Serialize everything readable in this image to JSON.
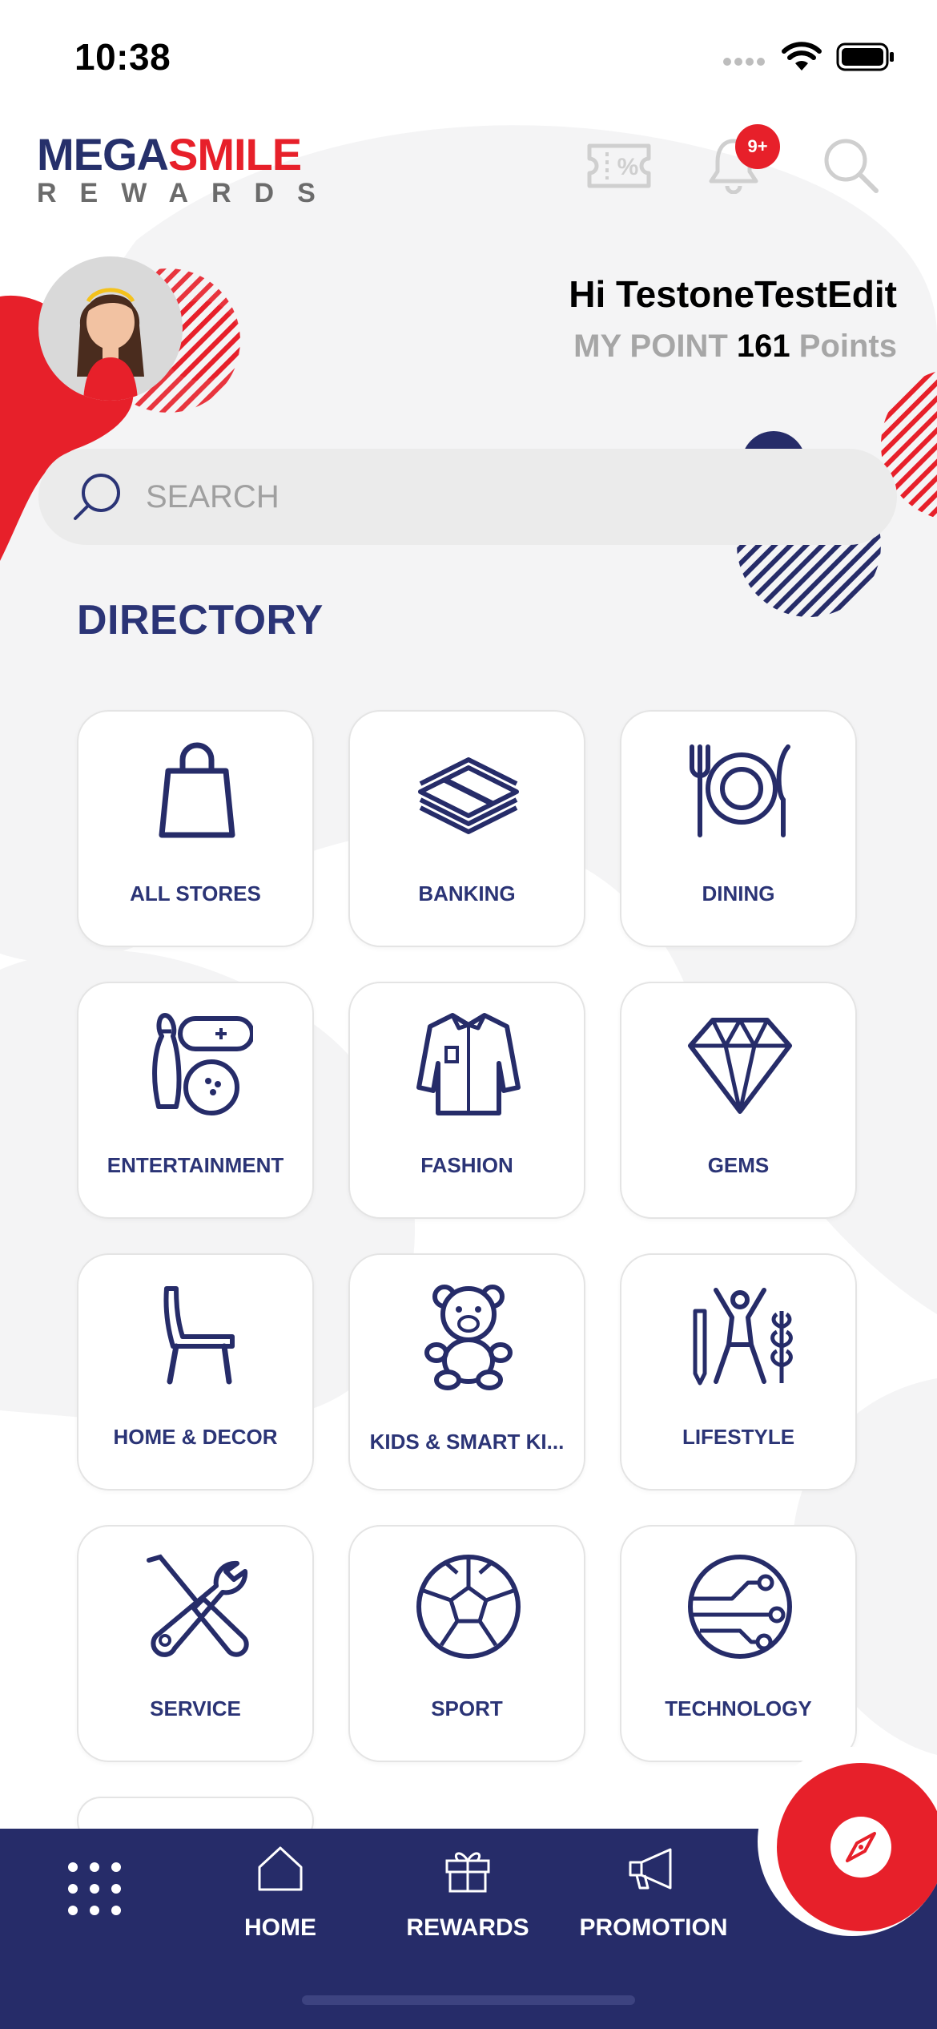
{
  "status_bar": {
    "time": "10:38"
  },
  "header": {
    "logo_top_a": "MEGA",
    "logo_top_b": "SMILE",
    "logo_bottom": "REWARDS",
    "notification_badge": "9+",
    "icons": [
      "coupon-icon",
      "bell-icon",
      "search-icon"
    ]
  },
  "profile": {
    "greeting": "Hi TestoneTestEdit",
    "points_prefix": "MY POINT",
    "points_value": "161",
    "points_suffix": "Points"
  },
  "search": {
    "placeholder": "SEARCH"
  },
  "directory": {
    "title": "DIRECTORY",
    "items": [
      {
        "label": "ALL STORES",
        "icon": "shopping-bag-icon"
      },
      {
        "label": "BANKING",
        "icon": "money-stack-icon"
      },
      {
        "label": "DINING",
        "icon": "dining-plate-icon"
      },
      {
        "label": "ENTERTAINMENT",
        "icon": "bowling-gamepad-icon"
      },
      {
        "label": "FASHION",
        "icon": "shirt-icon"
      },
      {
        "label": "GEMS",
        "icon": "diamond-icon"
      },
      {
        "label": "HOME & DECOR",
        "icon": "chair-icon"
      },
      {
        "label": "KIDS & SMART KI...",
        "icon": "teddy-bear-icon"
      },
      {
        "label": "LIFESTYLE",
        "icon": "lifestyle-person-icon"
      },
      {
        "label": "SERVICE",
        "icon": "tools-icon"
      },
      {
        "label": "SPORT",
        "icon": "soccer-ball-icon"
      },
      {
        "label": "TECHNOLOGY",
        "icon": "circuit-globe-icon"
      }
    ]
  },
  "bottom_nav": {
    "items": [
      {
        "label": "",
        "icon": "grid-menu-icon"
      },
      {
        "label": "HOME",
        "icon": "home-icon"
      },
      {
        "label": "REWARDS",
        "icon": "gift-icon"
      },
      {
        "label": "PROMOTION",
        "icon": "megaphone-icon"
      }
    ],
    "fab_icon": "compass-icon"
  },
  "colors": {
    "brand_navy": "#262c69",
    "brand_red": "#e7202a",
    "tile_text": "#2b3476"
  }
}
